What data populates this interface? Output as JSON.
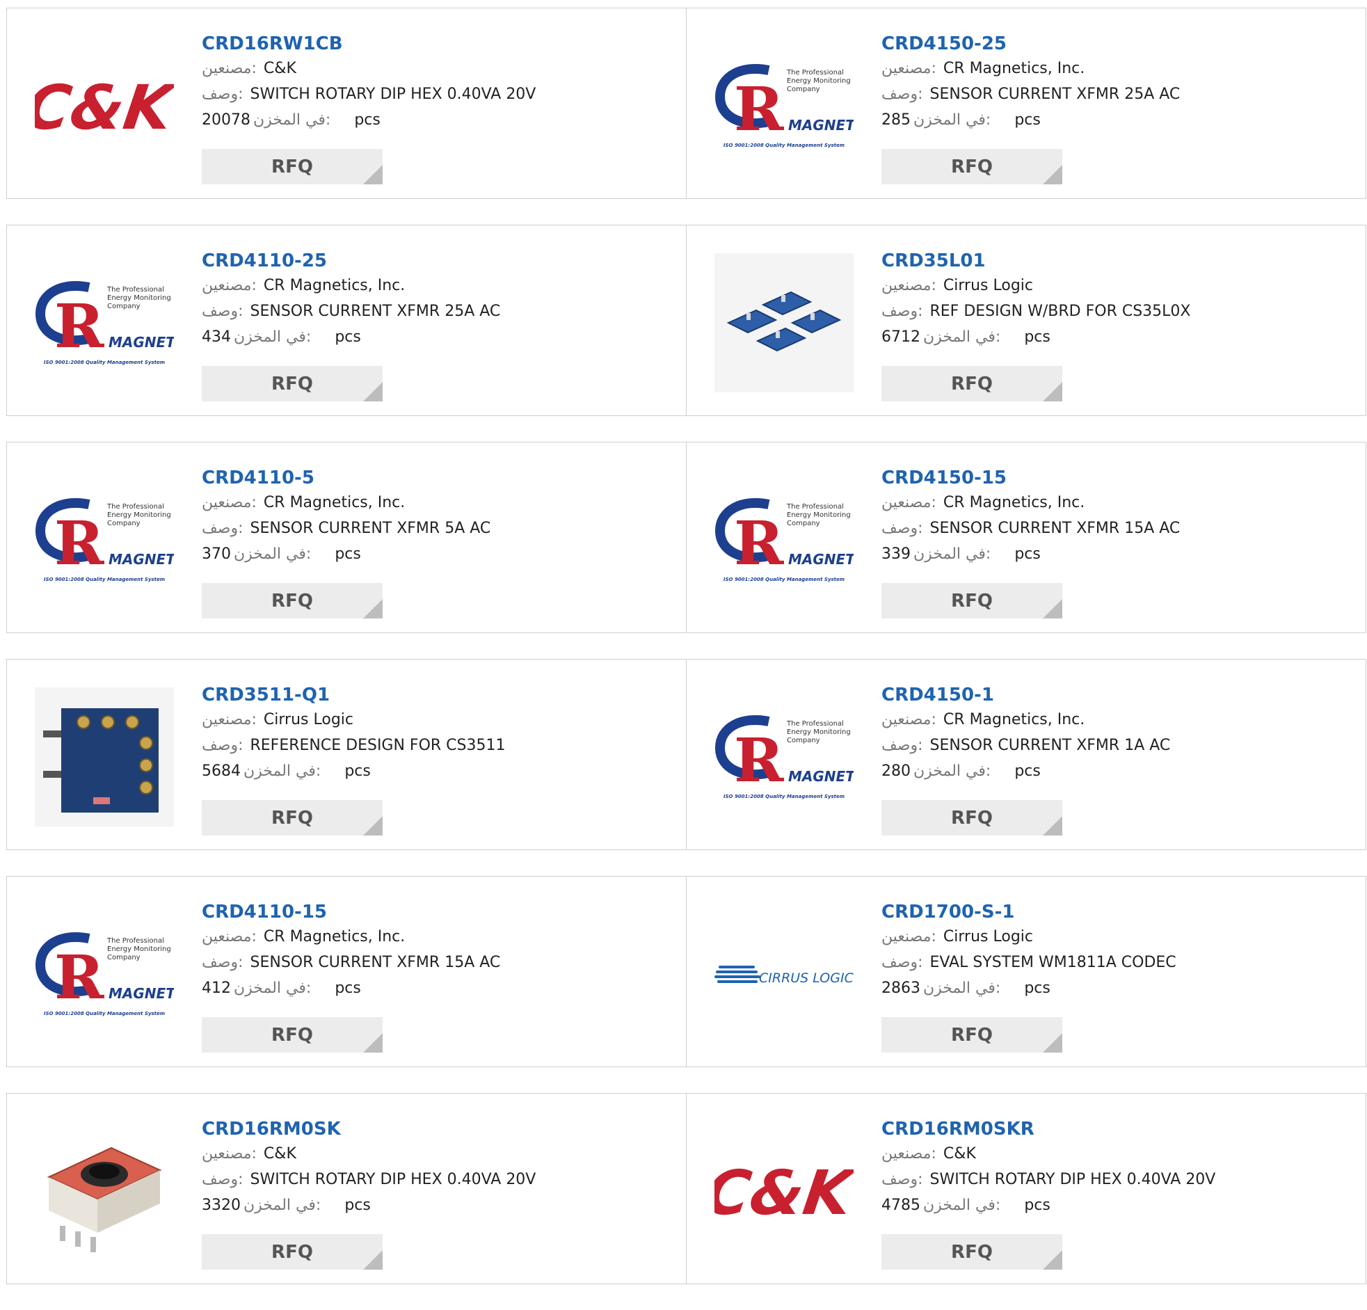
{
  "products": [
    {
      "pn": "CRD16RW1CB",
      "mfr_label": "مصنعين:",
      "mfr": "C&K",
      "desc_label": "وصف:",
      "desc": "SWITCH ROTARY DIP HEX 0.40VA 20V",
      "stock_label": "في المخزن:",
      "stock": "20078",
      "unit": "pcs",
      "rfq": "RFQ",
      "image": "ck-logo"
    },
    {
      "pn": "CRD4150-25",
      "mfr_label": "مصنعين:",
      "mfr": "CR Magnetics, Inc.",
      "desc_label": "وصف:",
      "desc": "SENSOR CURRENT XFMR 25A AC",
      "stock_label": "في المخزن:",
      "stock": "285",
      "unit": "pcs",
      "rfq": "RFQ",
      "image": "cr-magnetics-logo"
    },
    {
      "pn": "CRD4110-25",
      "mfr_label": "مصنعين:",
      "mfr": "CR Magnetics, Inc.",
      "desc_label": "وصف:",
      "desc": "SENSOR CURRENT XFMR 25A AC",
      "stock_label": "في المخزن:",
      "stock": "434",
      "unit": "pcs",
      "rfq": "RFQ",
      "image": "cr-magnetics-logo"
    },
    {
      "pn": "CRD35L01",
      "mfr_label": "مصنعين:",
      "mfr": "Cirrus Logic",
      "desc_label": "وصف:",
      "desc": "REF DESIGN W/BRD FOR CS35L0X",
      "stock_label": "في المخزن:",
      "stock": "6712",
      "unit": "pcs",
      "rfq": "RFQ",
      "image": "boards-photo"
    },
    {
      "pn": "CRD4110-5",
      "mfr_label": "مصنعين:",
      "mfr": "CR Magnetics, Inc.",
      "desc_label": "وصف:",
      "desc": "SENSOR CURRENT XFMR 5A AC",
      "stock_label": "في المخزن:",
      "stock": "370",
      "unit": "pcs",
      "rfq": "RFQ",
      "image": "cr-magnetics-logo"
    },
    {
      "pn": "CRD4150-15",
      "mfr_label": "مصنعين:",
      "mfr": "CR Magnetics, Inc.",
      "desc_label": "وصف:",
      "desc": "SENSOR CURRENT XFMR 15A AC",
      "stock_label": "في المخزن:",
      "stock": "339",
      "unit": "pcs",
      "rfq": "RFQ",
      "image": "cr-magnetics-logo"
    },
    {
      "pn": "CRD3511-Q1",
      "mfr_label": "مصنعين:",
      "mfr": "Cirrus Logic",
      "desc_label": "وصف:",
      "desc": "REFERENCE DESIGN FOR CS3511",
      "stock_label": "في المخزن:",
      "stock": "5684",
      "unit": "pcs",
      "rfq": "RFQ",
      "image": "pcb-photo"
    },
    {
      "pn": "CRD4150-1",
      "mfr_label": "مصنعين:",
      "mfr": "CR Magnetics, Inc.",
      "desc_label": "وصف:",
      "desc": "SENSOR CURRENT XFMR 1A AC",
      "stock_label": "في المخزن:",
      "stock": "280",
      "unit": "pcs",
      "rfq": "RFQ",
      "image": "cr-magnetics-logo"
    },
    {
      "pn": "CRD4110-15",
      "mfr_label": "مصنعين:",
      "mfr": "CR Magnetics, Inc.",
      "desc_label": "وصف:",
      "desc": "SENSOR CURRENT XFMR 15A AC",
      "stock_label": "في المخزن:",
      "stock": "412",
      "unit": "pcs",
      "rfq": "RFQ",
      "image": "cr-magnetics-logo"
    },
    {
      "pn": "CRD1700-S-1",
      "mfr_label": "مصنعين:",
      "mfr": "Cirrus Logic",
      "desc_label": "وصف:",
      "desc": "EVAL SYSTEM WM1811A CODEC",
      "stock_label": "في المخزن:",
      "stock": "2863",
      "unit": "pcs",
      "rfq": "RFQ",
      "image": "cirrus-logic-logo"
    },
    {
      "pn": "CRD16RM0SK",
      "mfr_label": "مصنعين:",
      "mfr": "C&K",
      "desc_label": "وصف:",
      "desc": "SWITCH ROTARY DIP HEX 0.40VA 20V",
      "stock_label": "في المخزن:",
      "stock": "3320",
      "unit": "pcs",
      "rfq": "RFQ",
      "image": "rotary-switch-photo"
    },
    {
      "pn": "CRD16RM0SKR",
      "mfr_label": "مصنعين:",
      "mfr": "C&K",
      "desc_label": "وصف:",
      "desc": "SWITCH ROTARY DIP HEX 0.40VA 20V",
      "stock_label": "في المخزن:",
      "stock": "4785",
      "unit": "pcs",
      "rfq": "RFQ",
      "image": "ck-logo"
    }
  ],
  "logos": {
    "ck": "C&K",
    "cr_tagline": [
      "The Professional",
      "Energy Monitoring",
      "Company"
    ],
    "cr_word": "MAGNETICS",
    "cr_iso": "ISO 9001:2008 Quality Management System",
    "cirrus": "CIRRUS LOGIC"
  },
  "colors": {
    "link": "#1f63b0",
    "ck_red": "#c8202f",
    "cr_blue": "#1d3f8f",
    "rfq_bg": "#ececec"
  }
}
